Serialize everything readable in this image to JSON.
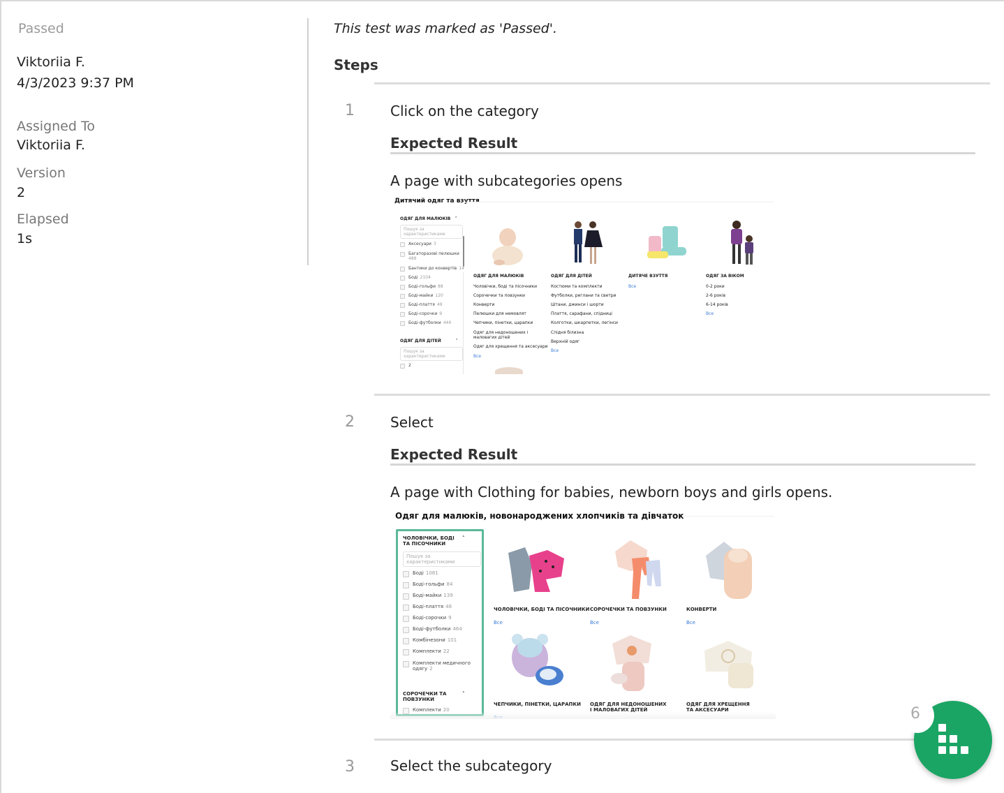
{
  "sidebar": {
    "status": "Passed",
    "author": "Viktoriia F.",
    "date": "4/3/2023 9:37 PM",
    "assigned_label": "Assigned To",
    "assigned_value": "Viktoriia F.",
    "version_label": "Version",
    "version_value": "2",
    "elapsed_label": "Elapsed",
    "elapsed_value": "1s"
  },
  "main": {
    "marked_text": "This test was marked as 'Passed'.",
    "steps_title": "Steps",
    "expected_title": "Expected Result",
    "steps": [
      {
        "num": "1",
        "text": "Click on the category",
        "expected": "A page with subcategories opens"
      },
      {
        "num": "2",
        "text": "Select",
        "expected": "A page with Clothing for babies, newborn boys and girls opens."
      },
      {
        "num": "3",
        "text": "Select the subcategory"
      }
    ]
  },
  "shot1": {
    "title": "Дитячий одяг та взуття",
    "group1": "ОДЯГ ДЛЯ МАЛЮКІВ",
    "search": "Пошук за характеристиками",
    "items": [
      {
        "label": "Аксесуари",
        "count": "3"
      },
      {
        "label": "Багаторазові пелюшки",
        "count": "489"
      },
      {
        "label": "Бантики до конвертів",
        "count": "14"
      },
      {
        "label": "Боді",
        "count": "2104"
      },
      {
        "label": "Боді-гольфи",
        "count": "88"
      },
      {
        "label": "Боді-майки",
        "count": "120"
      },
      {
        "label": "Боді-плаття",
        "count": "49"
      },
      {
        "label": "Боді-сорочки",
        "count": "9"
      },
      {
        "label": "Боді-футболки",
        "count": "444"
      }
    ],
    "group2": "ОДЯГ ДЛЯ ДІТЕЙ",
    "search2": "Пошук за характеристиками",
    "item_last": "2",
    "all_label": "Все",
    "cats": [
      {
        "title": "ОДЯГ ДЛЯ МАЛЮКІВ",
        "links": [
          "Чоловічки, боді та пісочники",
          "Сорочечки та повзунки",
          "Конверти",
          "Пелюшки для немовлят",
          "Чепчики, пінетки, царапки",
          "Одяг для недоношених і маловагих дітей",
          "Одяг для хрещення та аксесуари"
        ]
      },
      {
        "title": "ОДЯГ ДЛЯ ДІТЕЙ",
        "links": [
          "Костюми та комплекти",
          "Футболки, реглани та светри",
          "Штани, джинси і шорти",
          "Плаття, сарафани, спідниці",
          "Колготки, шкарпетки, легінси",
          "Спідня білизна",
          "Верхній одяг"
        ]
      },
      {
        "title": "ДИТЯЧЕ ВЗУТТЯ",
        "links": []
      },
      {
        "title": "ОДЯГ ЗА ВІКОМ",
        "links": [
          "0-2 роки",
          "2-6 років",
          "6-14 років"
        ]
      }
    ]
  },
  "shot2": {
    "title": "Одяг для малюків, новонароджених хлопчиків та дівчаток",
    "group1": "ЧОЛОВІЧКИ, БОДІ ТА ПІСОЧНИКИ",
    "search": "Пошук за характеристиками",
    "items": [
      {
        "label": "Боді",
        "count": "1081"
      },
      {
        "label": "Боді-гольфи",
        "count": "84"
      },
      {
        "label": "Боді-майки",
        "count": "139"
      },
      {
        "label": "Боді-плаття",
        "count": "48"
      },
      {
        "label": "Боді-сорочки",
        "count": "9"
      },
      {
        "label": "Боді-футболки",
        "count": "464"
      },
      {
        "label": "Комбінезони",
        "count": "101"
      },
      {
        "label": "Комплекти",
        "count": "22"
      },
      {
        "label": "Комплекти медичного одягу",
        "count": "2"
      }
    ],
    "group2": "СОРОЧЕЧКИ ТА ПОВЗУНКИ",
    "item_last": {
      "label": "Комплекти",
      "count": "20"
    },
    "all_label": "Все",
    "cats": [
      {
        "title": "ЧОЛОВІЧКИ, БОДІ ТА ПІСОЧНИКИ"
      },
      {
        "title": "СОРОЧЕЧКИ ТА ПОВЗУНКИ"
      },
      {
        "title": "КОНВЕРТИ"
      },
      {
        "title": "ЧЕПЧИКИ, ПІНЕТКИ, ЦАРАПКИ"
      },
      {
        "title": "ОДЯГ ДЛЯ НЕДОНОШЕНИХ І МАЛОВАГИХ ДІТЕЙ"
      },
      {
        "title": "ОДЯГ ДЛЯ ХРЕЩЕННЯ ТА АКСЕСУАРИ"
      }
    ]
  },
  "fab": {
    "count": "6",
    "icon": "grid-dots-icon",
    "color": "#1aa564"
  },
  "colors": {
    "accent": "#1aa564",
    "highlight": "#5bb89a",
    "link": "#3a7bd5"
  }
}
